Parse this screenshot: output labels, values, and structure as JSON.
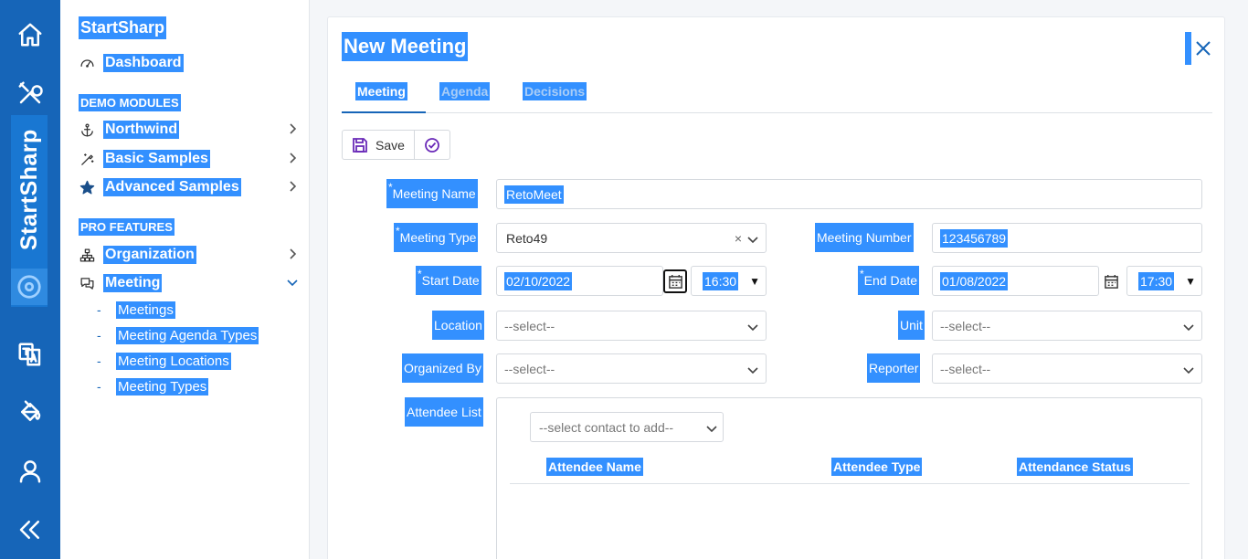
{
  "rail": {
    "brand": "StartSharp",
    "icons": [
      "home-icon",
      "tools-icon",
      "translate-icon",
      "paint-bucket-icon",
      "user-icon",
      "collapse-icon"
    ]
  },
  "sidebar": {
    "title": "StartSharp",
    "dashboard": "Dashboard",
    "demo_header": "DEMO MODULES",
    "northwind": "Northwind",
    "basic_samples": "Basic Samples",
    "advanced_samples": "Advanced Samples",
    "pro_header": "PRO FEATURES",
    "organization": "Organization",
    "meeting": "Meeting",
    "sub_items": [
      "Meetings",
      "Meeting Agenda Types",
      "Meeting Locations",
      "Meeting Types"
    ]
  },
  "dialog": {
    "title": "New Meeting",
    "tabs": [
      "Meeting",
      "Agenda",
      "Decisions"
    ],
    "save_label": "Save"
  },
  "form": {
    "required_mark": "*",
    "meeting_name_label": "Meeting Name",
    "meeting_name_value": "RetoMeet",
    "meeting_type_label": "Meeting Type",
    "meeting_type_value": "Reto49",
    "meeting_type_clear": "×",
    "meeting_number_label": "Meeting Number",
    "meeting_number_value": "123456789",
    "start_date_label": "Start Date",
    "start_date_value": "02/10/2022",
    "start_time_value": "16:30",
    "end_date_label": "End Date",
    "end_date_value": "01/08/2022",
    "end_time_value": "17:30",
    "location_label": "Location",
    "location_placeholder": "--select--",
    "unit_label": "Unit",
    "unit_placeholder": "--select--",
    "organized_by_label": "Organized By",
    "organized_by_placeholder": "--select--",
    "reporter_label": "Reporter",
    "reporter_placeholder": "--select--",
    "attendee_list_label": "Attendee List",
    "contact_placeholder": "--select contact to add--",
    "attendee_columns": [
      "Attendee Name",
      "Attendee Type",
      "Attendance Status"
    ]
  },
  "colors": {
    "rail_bg": "#1665b8",
    "selection": "#3390ff",
    "accent": "#6a2ab8"
  }
}
